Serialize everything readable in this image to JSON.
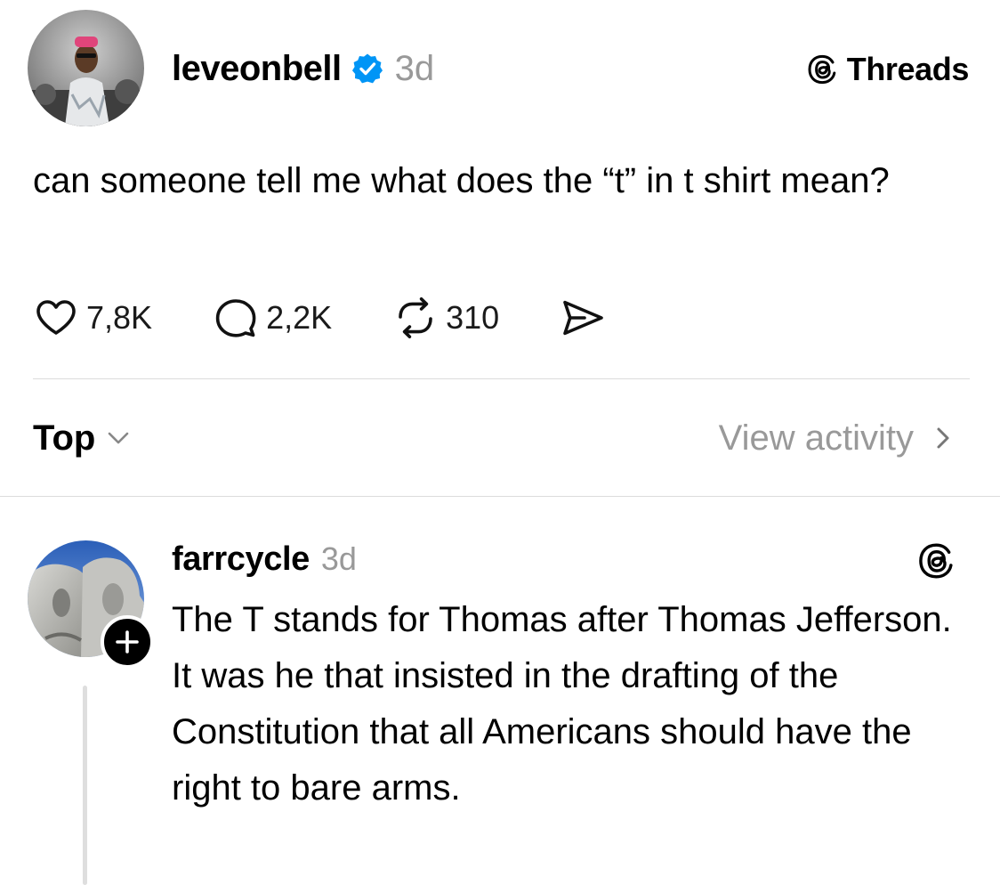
{
  "post": {
    "username": "leveonbell",
    "verified": true,
    "time": "3d",
    "text": "can someone tell me what does the “t” in t shirt mean?",
    "avatar_icon": "profile-photo",
    "brand": {
      "icon": "threads-logo-icon",
      "label": "Threads"
    },
    "actions": {
      "likes": "7,8K",
      "replies": "2,2K",
      "reposts": "310",
      "share_icon": "send-icon"
    }
  },
  "sort": {
    "label": "Top",
    "icon": "chevron-down-icon"
  },
  "view_activity": {
    "label": "View activity",
    "icon": "chevron-right-icon"
  },
  "reply": {
    "username": "farrcycle",
    "time": "3d",
    "text": "The T stands for Thomas after Thomas Jefferson. It was he that insisted in the drafting of the Constitution that all Americans should have the right to bare arms.",
    "avatar_icon": "profile-photo",
    "follow_icon": "plus-icon",
    "brand_icon": "threads-logo-icon"
  },
  "colors": {
    "text": "#000000",
    "muted": "#999999",
    "verified": "#0095f6",
    "divider": "#dcdcdc"
  }
}
